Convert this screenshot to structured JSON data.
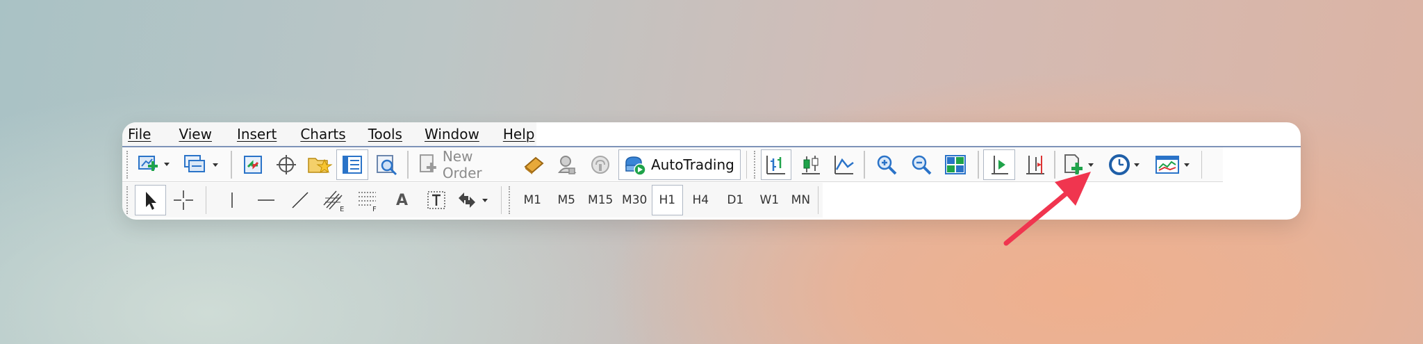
{
  "menu": {
    "file": "File",
    "view": "View",
    "insert": "Insert",
    "charts": "Charts",
    "tools": "Tools",
    "window": "Window",
    "help": "Help"
  },
  "toolbar": {
    "new_order_label": "New Order",
    "autotrading_label": "AutoTrading"
  },
  "line_studies": {
    "text_tool_label": "A"
  },
  "timeframes": [
    "M1",
    "M5",
    "M15",
    "M30",
    "H1",
    "H4",
    "D1",
    "W1",
    "MN"
  ],
  "active_timeframe": "H1",
  "icons": {
    "new_chart": "new-chart-icon",
    "profiles": "profiles-icon",
    "market_watch": "market-watch-icon",
    "data_window": "data-window-icon",
    "navigator": "navigator-icon",
    "terminal": "terminal-icon",
    "strategy_tester": "strategy-tester-icon",
    "metaeditor": "metaeditor-icon",
    "chart_shift": "chart-shift-icon",
    "auto_scroll": "auto-scroll-icon",
    "templates": "templates-icon"
  },
  "colors": {
    "accent_blue": "#2a73c8",
    "green": "#1fa34a",
    "annotation_arrow": "#f0354f"
  }
}
